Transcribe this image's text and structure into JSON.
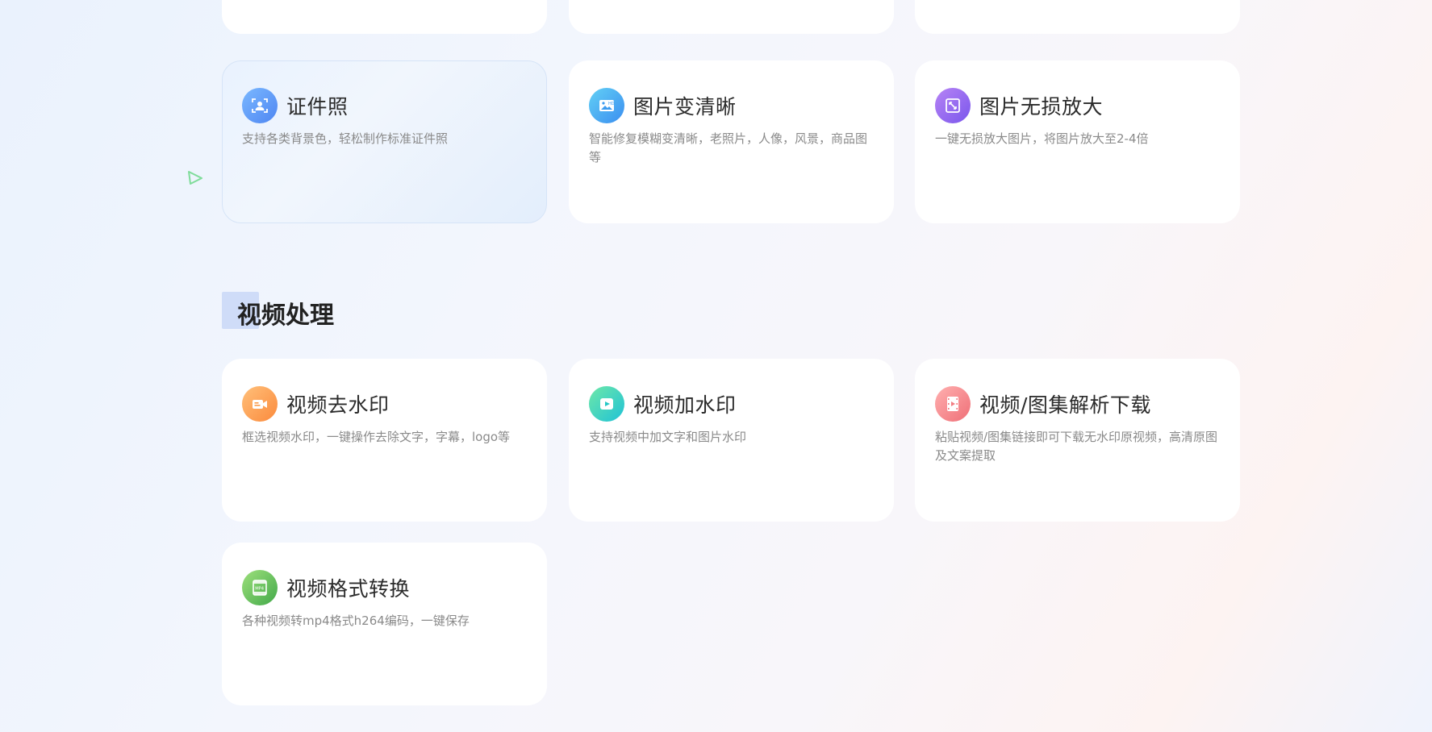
{
  "top_cards": [
    "",
    "",
    ""
  ],
  "image_cards": [
    {
      "title": "证件照",
      "desc": "支持各类背景色，轻松制作标准证件照",
      "icon": "id-photo-icon",
      "color": "#5b9cf6"
    },
    {
      "title": "图片变清晰",
      "desc": "智能修复模糊变清晰，老照片，人像，风景，商品图等",
      "icon": "hd-image-icon",
      "color": "#3fa9f0"
    },
    {
      "title": "图片无损放大",
      "desc": "一键无损放大图片，将图片放大至2-4倍",
      "icon": "expand-icon",
      "color": "#8d63ef"
    }
  ],
  "section": {
    "title": "视频处理"
  },
  "video_cards": [
    {
      "title": "视频去水印",
      "desc": "框选视频水印，一键操作去除文字，字幕，logo等",
      "icon": "video-camera-icon",
      "color": "#fb9a48"
    },
    {
      "title": "视频加水印",
      "desc": "支持视频中加文字和图片水印",
      "icon": "video-play-icon",
      "color": "#2fd0c0"
    },
    {
      "title": "视频/图集解析下载",
      "desc": "粘贴视频/图集链接即可下载无水印原视频，高清原图及文案提取",
      "icon": "film-icon",
      "color": "#f27d82"
    },
    {
      "title": "视频格式转换",
      "desc": "各种视频转mp4格式h264编码，一键保存",
      "icon": "mp4-film-icon",
      "color": "#5cbc5a"
    }
  ]
}
